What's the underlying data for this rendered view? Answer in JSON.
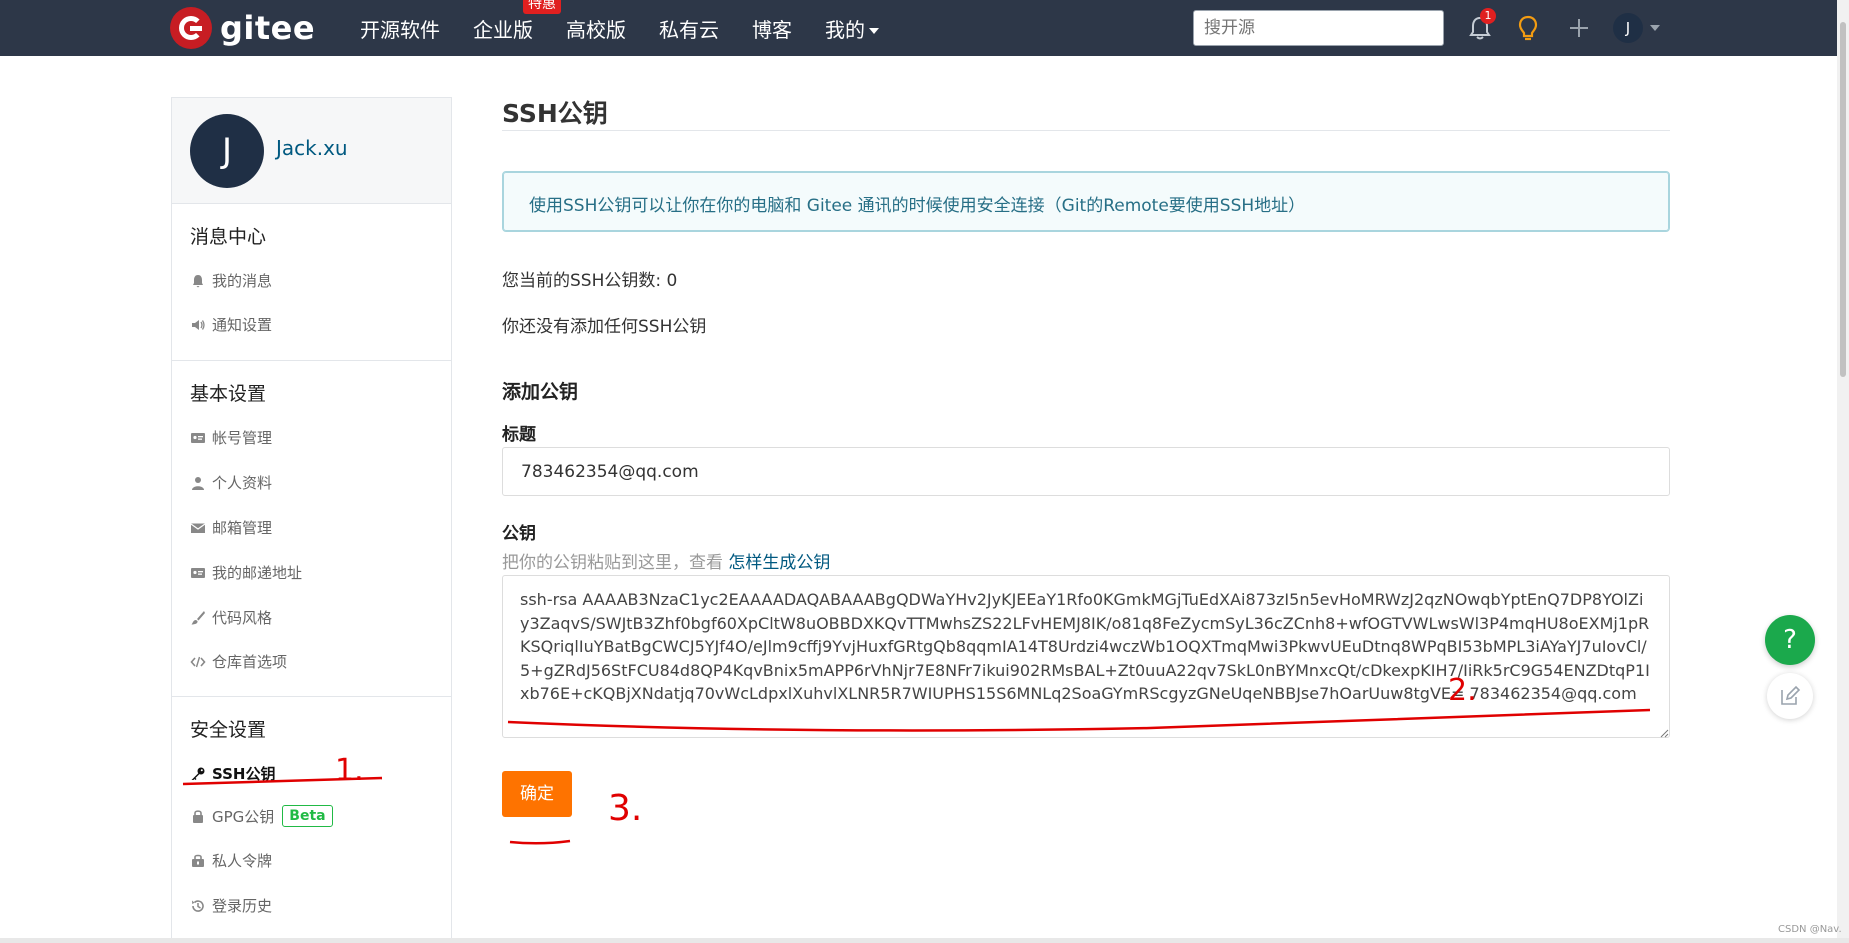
{
  "topbar": {
    "brand": "gitee",
    "nav": [
      "开源软件",
      "企业版",
      "高校版",
      "私有云",
      "博客",
      "我的"
    ],
    "hot_badge": "特惠",
    "search_placeholder": "搜开源",
    "notification_count": "1",
    "user_initial": "J"
  },
  "sidebar": {
    "avatar_initial": "J",
    "username": "Jack.xu",
    "sections": [
      {
        "title": "消息中心",
        "items": [
          "我的消息",
          "通知设置"
        ]
      },
      {
        "title": "基本设置",
        "items": [
          "帐号管理",
          "个人资料",
          "邮箱管理",
          "我的邮递地址",
          "代码风格",
          "仓库首选项"
        ]
      },
      {
        "title": "安全设置",
        "items": [
          "SSH公钥",
          "GPG公钥",
          "私人令牌",
          "登录历史"
        ]
      }
    ],
    "beta_label": "Beta"
  },
  "main": {
    "title": "SSH公钥",
    "info": "使用SSH公钥可以让你在你的电脑和 Gitee 通讯的时候使用安全连接（Git的Remote要使用SSH地址）",
    "count_text": "您当前的SSH公钥数: 0",
    "empty_text": "你还没有添加任何SSH公钥",
    "add_title": "添加公钥",
    "label_title": "标题",
    "title_value": "783462354@qq.com",
    "label_key": "公钥",
    "hint_prefix": "把你的公钥粘贴到这里，查看",
    "hint_link": "怎样生成公钥",
    "key_value": "ssh-rsa AAAAB3NzaC1yc2EAAAADAQABAAABgQDWaYHv2JyKJEEaY1Rfo0KGmkMGjTuEdXAi873zI5n5evHoMRWzJ2qzNOwqbYptEnQ7DP8YOlZiy3ZaqvS/SWJtB3Zhf0bgf60XpCltW8uOBBDXKQvTTMwhsZS22LFvHEMJ8IK/o81q8FeZycmSyL36cZCnh8+wfOGTVWLwsWl3P4mqHU8oEXMj1pRKSQriqlIuYBatBgCWCJ5YJf4O/eJlm9cffj9YvjHuxfGRtgQb8qqmIA14T8Urdzi4wczWb1OQXTmqMwi3PkwvUEuDtnq8WPqBI53bMPL3iAYaYJ7uIovCl/5+gZRdJ56StFCU84d8QP4KqvBnix5mAPP6rVhNjr7E8NFr7ikui902RMsBAL+Zt0uuA22qv7SkL0nBYMnxcQt/cDkexpKIH7/IiRk5rC9G54ENZDtqP1Ixb76E+cKQBjXNdatjq70vWcLdpxlXuhvlXLNR5R7WIUPHS15S6MNLq2SoaGYmRScgyzGNeUqeNBBJse7hOarUuw8tgVE= 783462354@qq.com",
    "submit_label": "确定"
  },
  "floating": {
    "help_label": "?"
  },
  "annotations": [
    "1.",
    "2.",
    "3."
  ],
  "watermark": "CSDN @Nav.",
  "colors": {
    "topbar": "#2d3748",
    "accent_orange": "#fe7300",
    "link": "#005980",
    "help_green": "#1ba94c",
    "annotation_red": "#e00000"
  }
}
